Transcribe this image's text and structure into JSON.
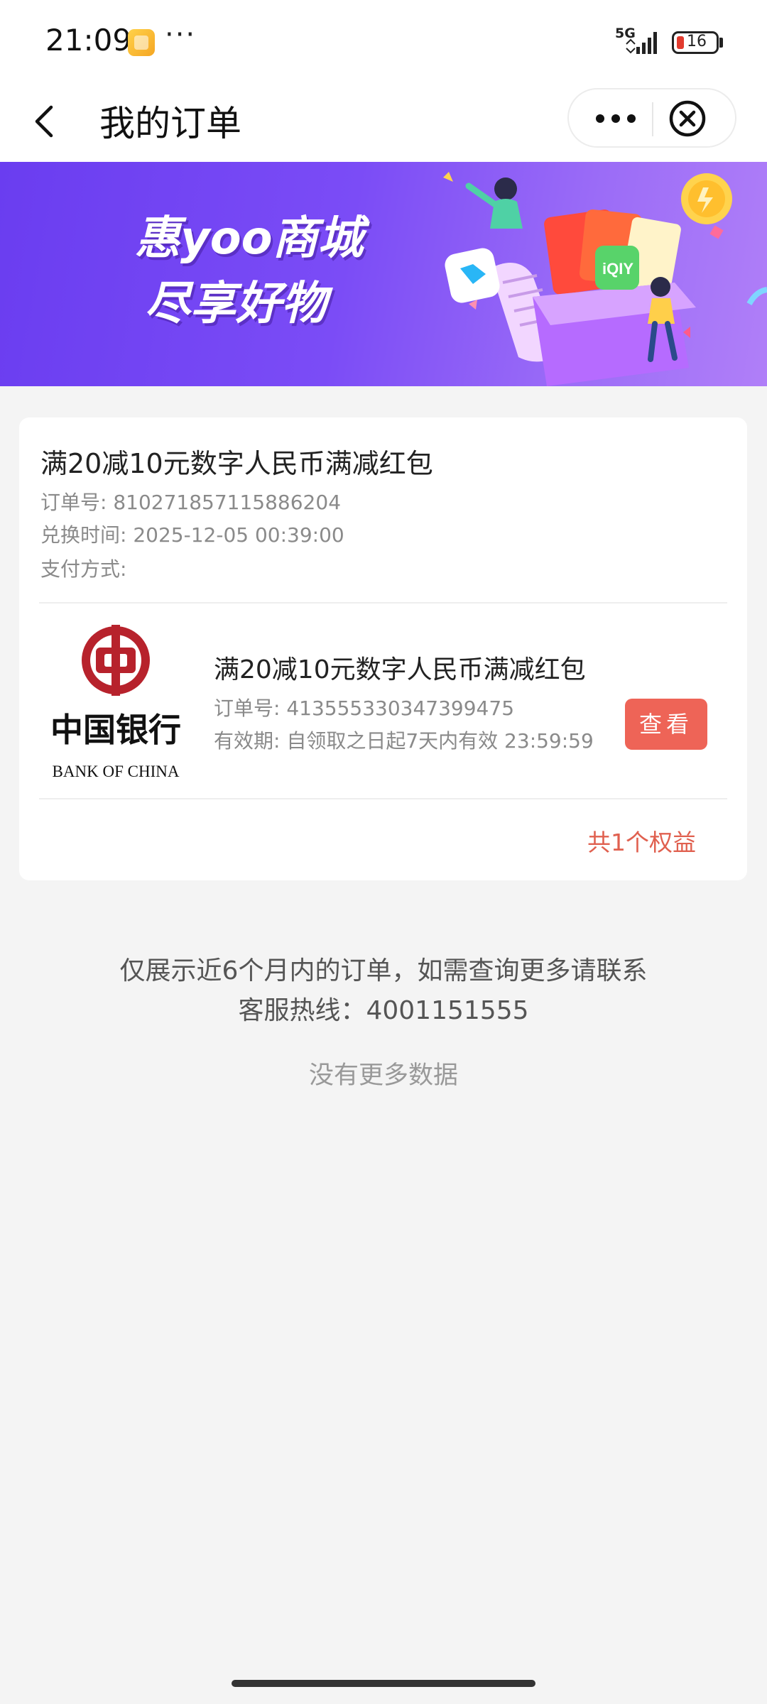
{
  "status_bar": {
    "time": "21:09",
    "network": "5G",
    "battery_level": "16",
    "more_glyph": "···",
    "icons": [
      "app-notification-icon",
      "signal-icon",
      "battery-icon"
    ]
  },
  "nav": {
    "title": "我的订单",
    "icons": [
      "back-arrow-icon",
      "more-dots-icon",
      "close-circle-icon"
    ]
  },
  "banner": {
    "line1": "惠yoo商城",
    "line2": "尽享好物"
  },
  "order": {
    "title": "满20减10元数字人民币满减红包",
    "order_no_label": "订单号:",
    "order_no": "810271857115886204",
    "exchange_time_label": "兑换时间:",
    "exchange_time": "2025-12-05 00:39:00",
    "payment_label": "支付方式:",
    "payment_value": "",
    "benefit": {
      "logo_text_cn": "中国银行",
      "logo_text_en": "BANK OF CHINA",
      "name": "满20减10元数字人民币满减红包",
      "order_no_label": "订单号:",
      "order_no": "413555330347399475",
      "validity_label": "有效期:",
      "validity": "自领取之日起7天内有效 23:59:59",
      "view_label": "查看"
    },
    "summary": "共1个权益"
  },
  "footer": {
    "notice_line1": "仅展示近6个月内的订单，如需查询更多请联系",
    "notice_line2": "客服热线：4001151555",
    "no_more": "没有更多数据"
  },
  "colors": {
    "accent_red": "#ee6457",
    "summary_red": "#e0604f",
    "banner_purple": "#7b4cf6",
    "boc_red": "#b7222c"
  }
}
